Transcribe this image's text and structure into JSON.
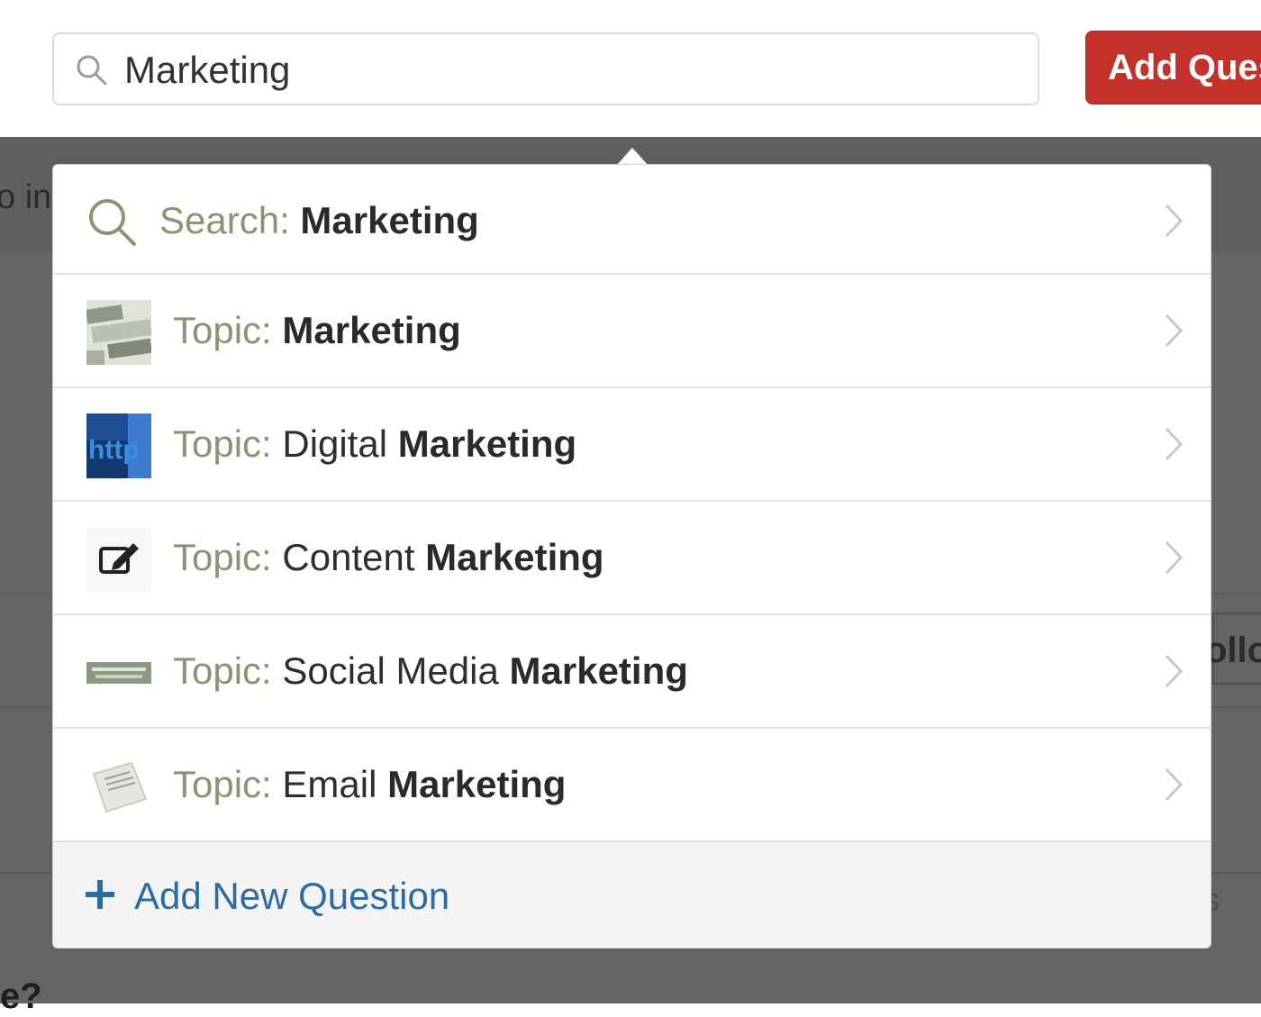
{
  "header": {
    "search_value": "Marketing",
    "add_question_label": "Add Question"
  },
  "background": {
    "left_text": "o in",
    "follow_text": "ollo",
    "s_text": "s",
    "question_text": "e?"
  },
  "dropdown": {
    "search": {
      "prefix": "Search: ",
      "bold": "Marketing"
    },
    "topics": [
      {
        "prefix": "Topic: ",
        "normal": "",
        "bold": "Marketing",
        "icon": "keyboard-marketing-thumb"
      },
      {
        "prefix": "Topic: ",
        "normal": "Digital ",
        "bold": "Marketing",
        "icon": "http-thumb"
      },
      {
        "prefix": "Topic: ",
        "normal": "Content ",
        "bold": "Marketing",
        "icon": "edit-pencil-thumb"
      },
      {
        "prefix": "Topic: ",
        "normal": "Social Media ",
        "bold": "Marketing",
        "icon": "social-media-thumb"
      },
      {
        "prefix": "Topic: ",
        "normal": "Email ",
        "bold": "Marketing",
        "icon": "email-thumb"
      }
    ],
    "add_new_label": "Add New Question"
  },
  "colors": {
    "accent_red": "#c3312b",
    "link_blue": "#2b6ca3",
    "prefix_olive": "#8c9375"
  }
}
